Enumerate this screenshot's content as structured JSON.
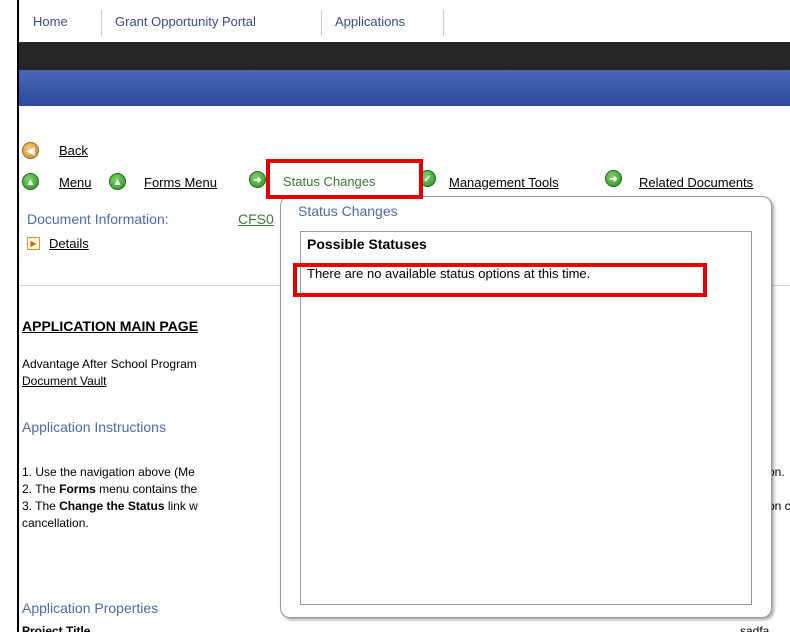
{
  "topnav": {
    "items": [
      "Home",
      "Grant Opportunity Portal",
      "Applications"
    ]
  },
  "nav": {
    "back": "Back",
    "menu": "Menu",
    "forms_menu": "Forms Menu",
    "status_changes": "Status Changes",
    "management_tools": "Management Tools",
    "related_documents": "Related Documents"
  },
  "doc_info": {
    "label": "Document Information:",
    "link": "CFS0",
    "details": "Details"
  },
  "main": {
    "heading": "APPLICATION MAIN PAGE",
    "program_line": "Advantage After School Program",
    "vault_link": "Document Vault",
    "instructions_title": "Application Instructions",
    "instr1": "1. Use the navigation above (Me",
    "instr1_tail": "on.",
    "instr2_prefix": "2. The ",
    "instr2_bold": "Forms",
    "instr2_suffix": " menu contains the",
    "instr3_prefix": "3. The ",
    "instr3_bold": "Change the Status",
    "instr3_suffix": " link w",
    "instr3_tail": "on c",
    "instr3_cont": "cancellation.",
    "properties_title": "Application Properties",
    "project_title_label": "Project Title",
    "project_title_tail": "sadfa"
  },
  "popup": {
    "title": "Status Changes",
    "header": "Possible Statuses",
    "message": "There are no available status options at this time."
  },
  "colors": {
    "highlight": "#e60000",
    "link_blue": "#4a6ba7",
    "nav_dark": "#262626",
    "nav_blue": "#2b4b9f"
  }
}
